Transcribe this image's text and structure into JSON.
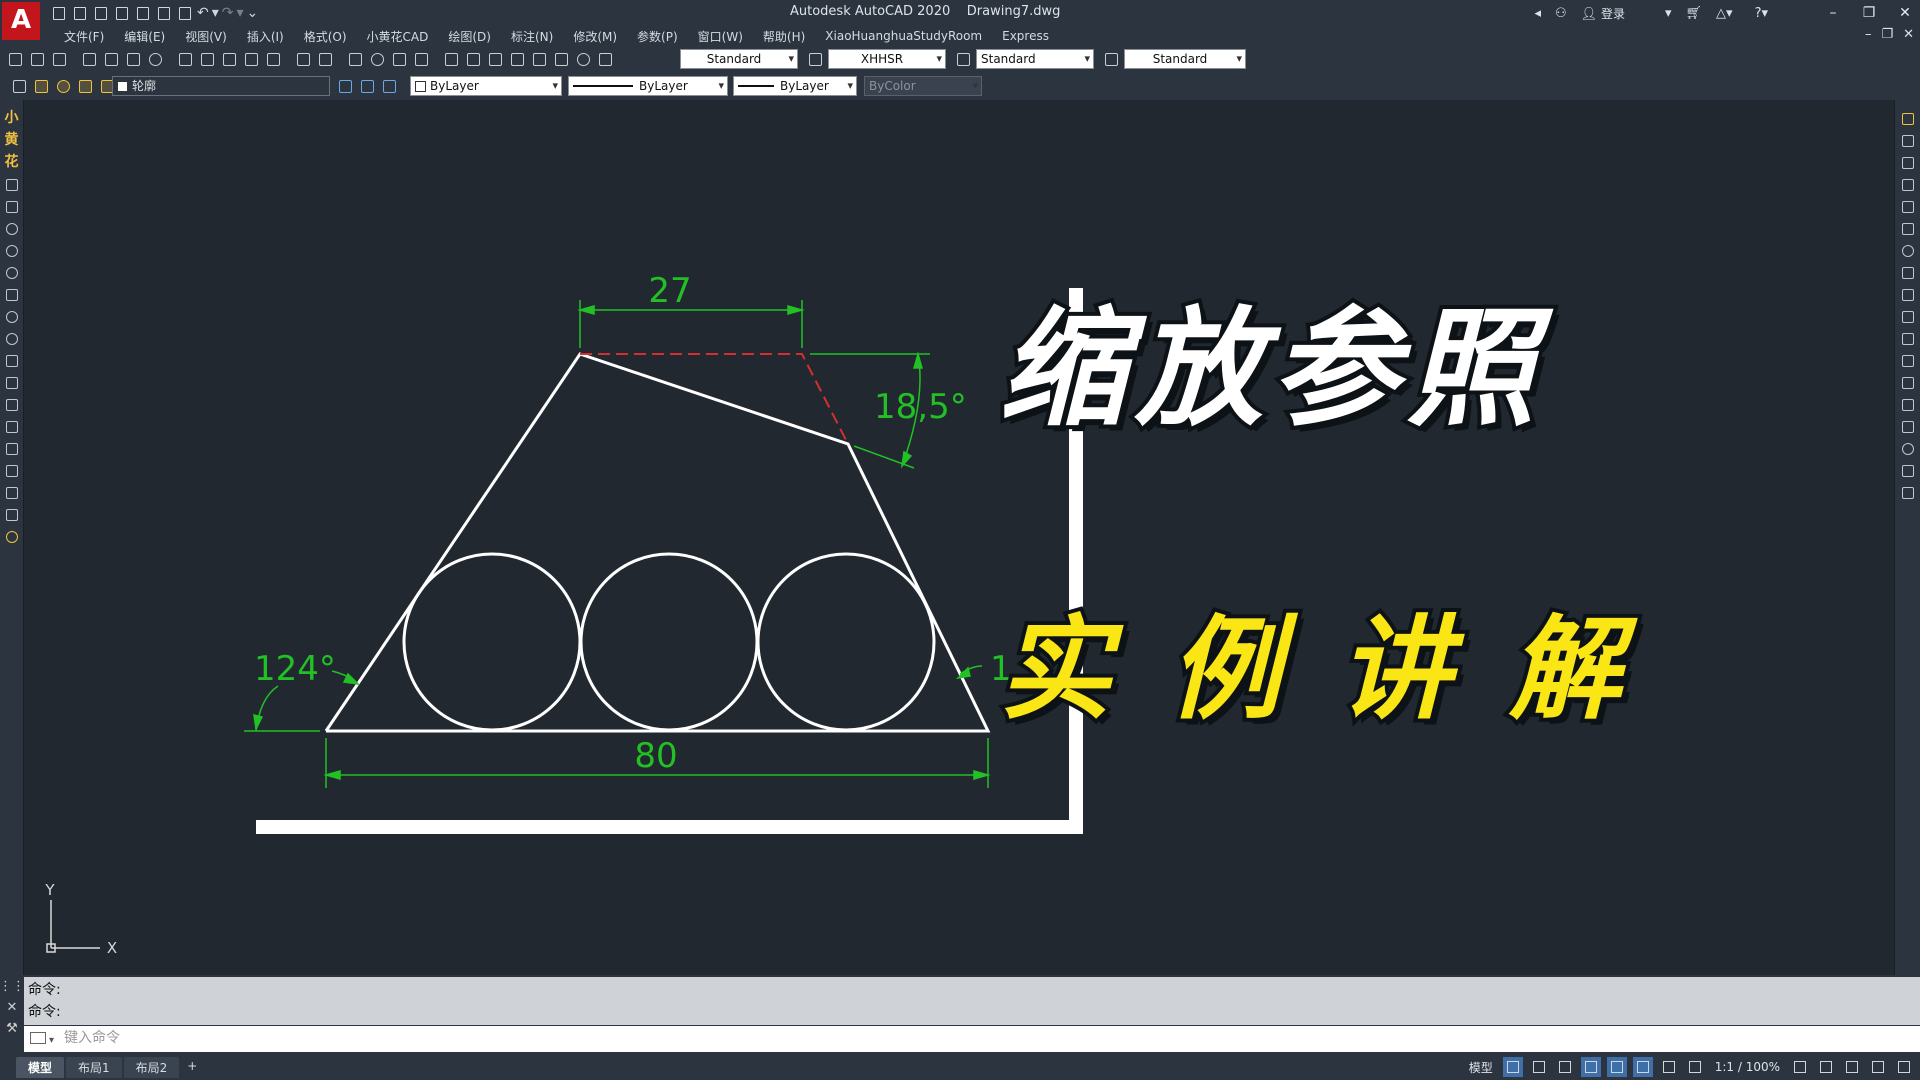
{
  "app": {
    "logo_letter": "A",
    "window_title": "Autodesk AutoCAD 2020    Drawing7.dwg",
    "login_label": "登录",
    "colors": {
      "chrome": "#2c3440",
      "canvas": "#212830",
      "dimension": "#22c025",
      "accent_yellow": "#fae615",
      "logo_red": "#c3161c"
    }
  },
  "menu": {
    "items": [
      "文件(F)",
      "编辑(E)",
      "视图(V)",
      "插入(I)",
      "格式(O)",
      "小黄花CAD",
      "绘图(D)",
      "标注(N)",
      "修改(M)",
      "参数(P)",
      "窗口(W)",
      "帮助(H)",
      "XiaoHuanghuaStudyRoom",
      "Express"
    ]
  },
  "toolbar1": {
    "text_style": "Standard",
    "dim_style": "XHHSR",
    "table_style": "Standard",
    "multileader_style": "Standard"
  },
  "toolbar2": {
    "layer": "轮廓",
    "color": "ByLayer",
    "linetype": "ByLayer",
    "lineweight": "ByLayer",
    "plot_style": "ByColor"
  },
  "left_toolbar": {
    "brand_chars": [
      "小",
      "黄",
      "花"
    ]
  },
  "drawing": {
    "dimensions": {
      "top_width": "27",
      "bottom_width": "80",
      "left_angle": "124°",
      "chamfer_angle": "18,5°",
      "right_angle_partial": "1"
    },
    "ucs": {
      "x_label": "X",
      "y_label": "Y"
    },
    "overlay_title": "缩放参照",
    "overlay_subtitle": "实例讲解"
  },
  "command": {
    "history": [
      "命令:",
      "命令:"
    ],
    "placeholder": "键入命令"
  },
  "status": {
    "tabs": [
      "模型",
      "布局1",
      "布局2"
    ],
    "plus_label": "+",
    "model_label": "模型",
    "scale": "1:1 / 100%"
  }
}
